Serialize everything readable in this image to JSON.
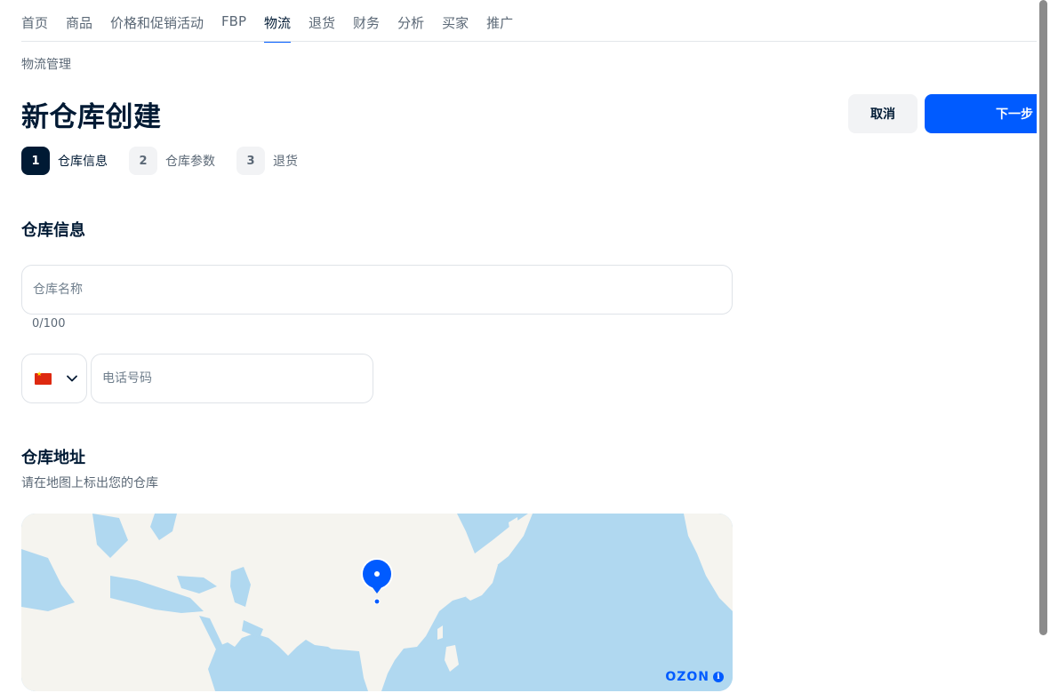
{
  "nav": {
    "items": [
      {
        "label": "首页",
        "active": false
      },
      {
        "label": "商品",
        "active": false
      },
      {
        "label": "价格和促销活动",
        "active": false
      },
      {
        "label": "FBP",
        "active": false
      },
      {
        "label": "物流",
        "active": true
      },
      {
        "label": "退货",
        "active": false
      },
      {
        "label": "财务",
        "active": false
      },
      {
        "label": "分析",
        "active": false
      },
      {
        "label": "买家",
        "active": false
      },
      {
        "label": "推广",
        "active": false
      }
    ]
  },
  "breadcrumb": "物流管理",
  "page": {
    "title": "新仓库创建",
    "cancel_label": "取消",
    "next_label": "下一步"
  },
  "steps": [
    {
      "number": "1",
      "label": "仓库信息",
      "active": true
    },
    {
      "number": "2",
      "label": "仓库参数",
      "active": false
    },
    {
      "number": "3",
      "label": "退货",
      "active": false
    }
  ],
  "warehouse_info": {
    "title": "仓库信息",
    "name_placeholder": "仓库名称",
    "name_value": "",
    "name_counter": "0/100",
    "country_flag_icon": "china-flag-icon",
    "phone_placeholder": "电话号码",
    "phone_value": ""
  },
  "warehouse_address": {
    "title": "仓库地址",
    "subtitle": "请在地图上标出您的仓库",
    "map_brand": "OZON",
    "map_info_icon": "info-icon"
  },
  "colors": {
    "accent": "#005bff",
    "text_primary": "#001a34",
    "text_secondary": "#5b6876",
    "map_water": "#b0d8f0",
    "map_land": "#f5f4ef"
  }
}
